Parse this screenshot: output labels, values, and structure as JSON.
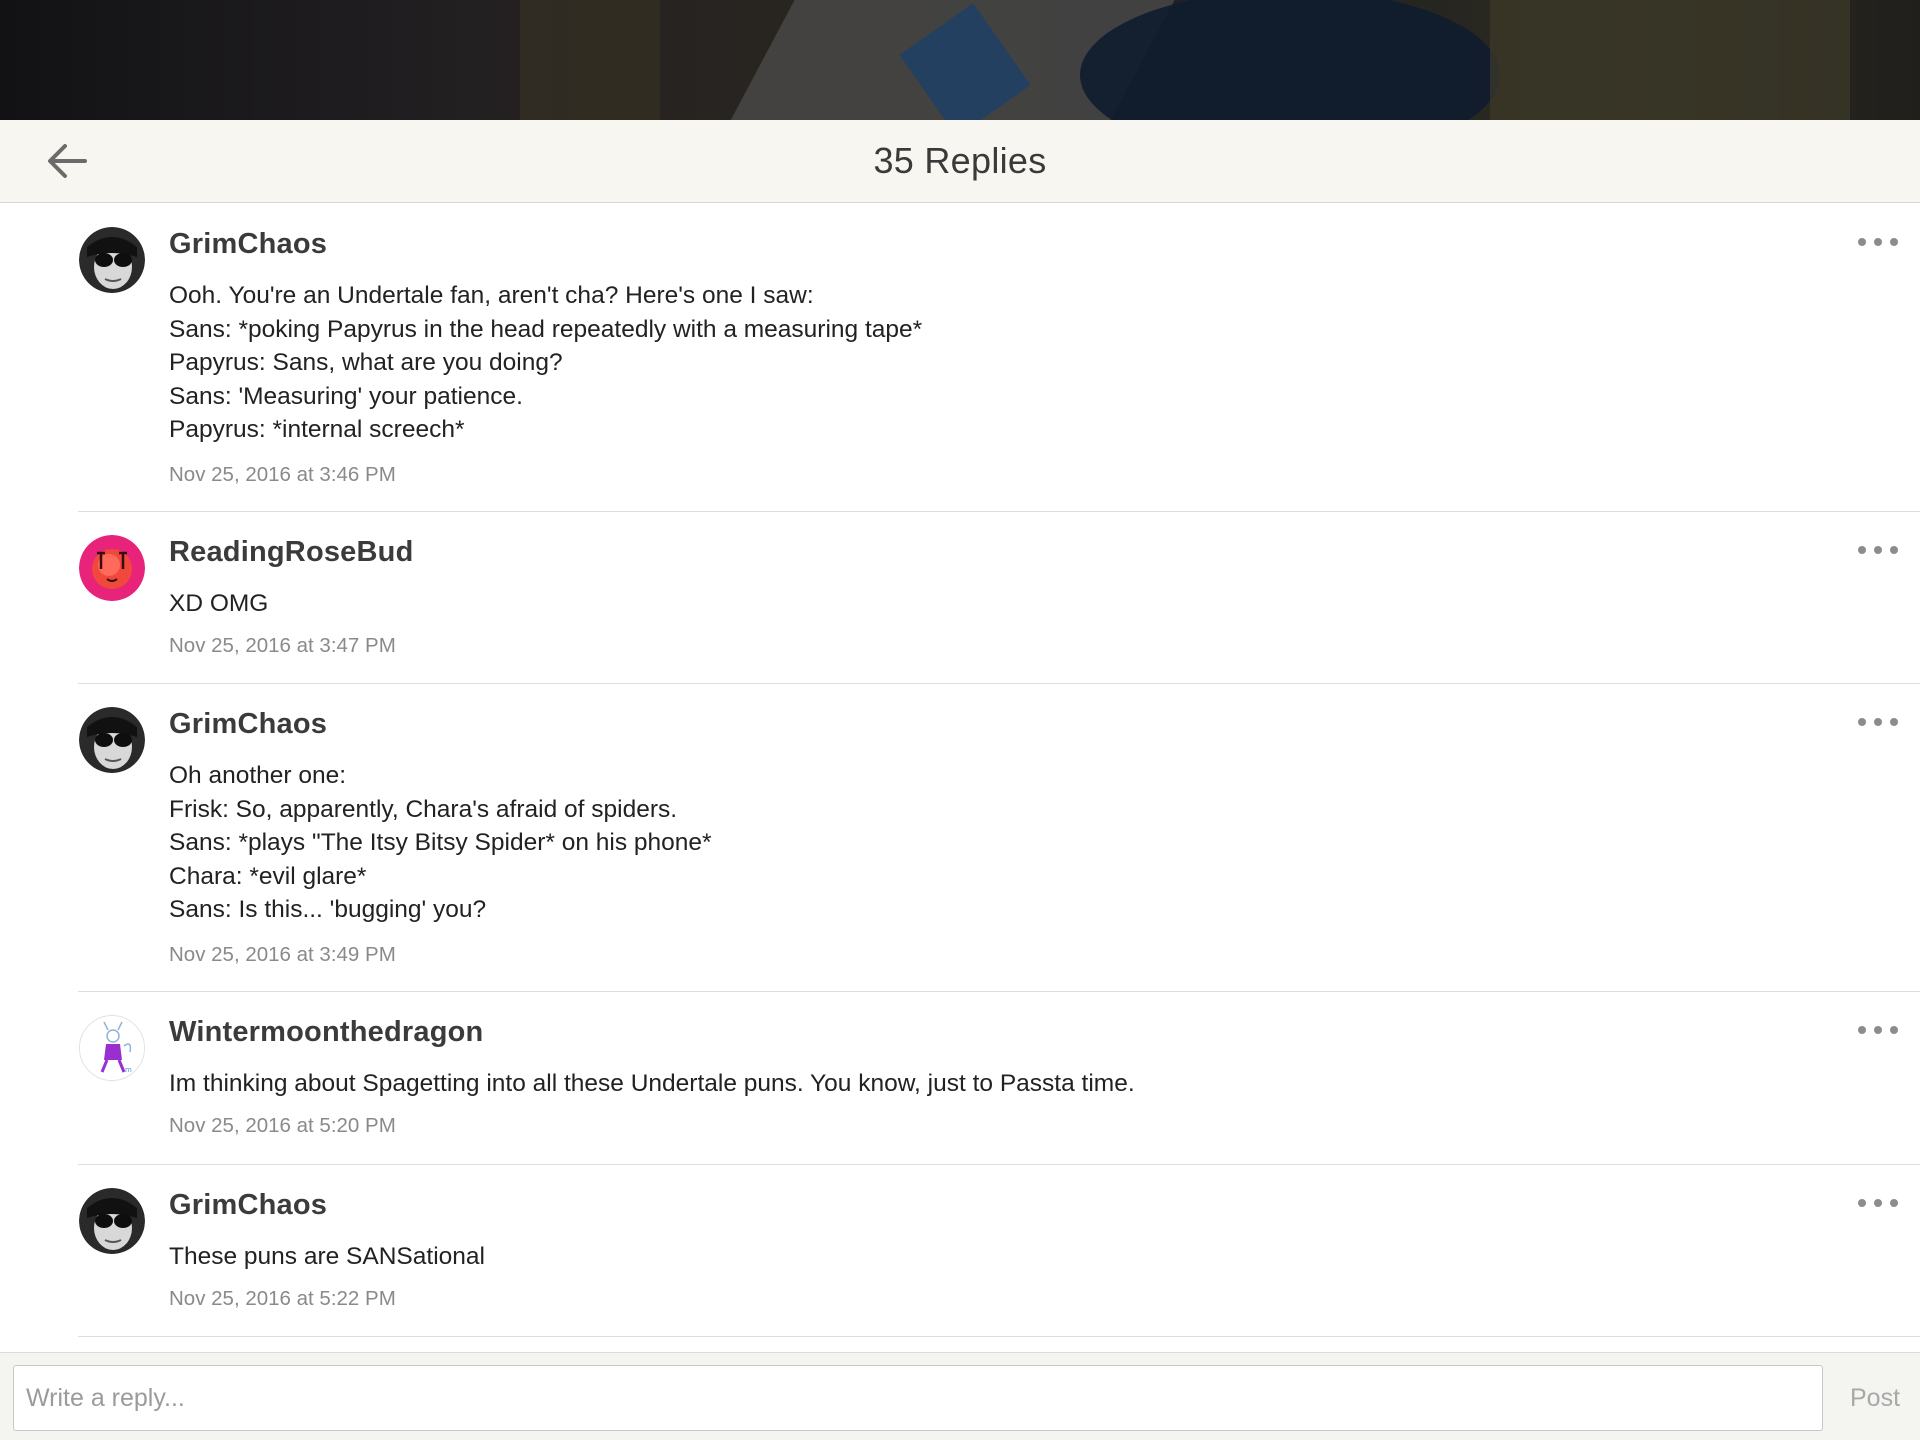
{
  "header": {
    "title": "35 Replies",
    "back_icon": "arrow-left-icon"
  },
  "replies": [
    {
      "author": "GrimChaos",
      "avatar": "grimchaos-avatar",
      "body": "Ooh. You're an Undertale fan, aren't cha? Here's one I saw:\nSans: *poking Papyrus in the head repeatedly with a measuring tape*\nPapyrus: Sans, what are you doing?\nSans: 'Measuring' your patience.\nPapyrus: *internal screech*",
      "timestamp": "Nov 25, 2016 at 3:46 PM"
    },
    {
      "author": "ReadingRoseBud",
      "avatar": "rose-avatar",
      "body": "XD OMG",
      "timestamp": "Nov 25, 2016 at 3:47 PM"
    },
    {
      "author": "GrimChaos",
      "avatar": "grimchaos-avatar",
      "body": "Oh another one:\nFrisk: So, apparently, Chara's afraid of spiders.\nSans: *plays \"The Itsy Bitsy Spider* on his phone*\nChara: *evil glare*\nSans: Is this... 'bugging' you?",
      "timestamp": "Nov 25, 2016 at 3:49 PM"
    },
    {
      "author": "Wintermoonthedragon",
      "avatar": "dragon-sketch-avatar",
      "body": "Im thinking about Spagetting into all these Undertale puns. You know, just to Passta time.",
      "timestamp": "Nov 25, 2016 at 5:20 PM"
    },
    {
      "author": "GrimChaos",
      "avatar": "grimchaos-avatar",
      "body": "These puns are SANSational",
      "timestamp": "Nov 25, 2016 at 5:22 PM"
    }
  ],
  "composer": {
    "placeholder": "Write a reply...",
    "post_label": "Post"
  },
  "colors": {
    "header_bg": "#f7f6f1",
    "divider": "#dededa",
    "timestamp": "#8a8a8a",
    "post_disabled": "#a8a8a8"
  }
}
